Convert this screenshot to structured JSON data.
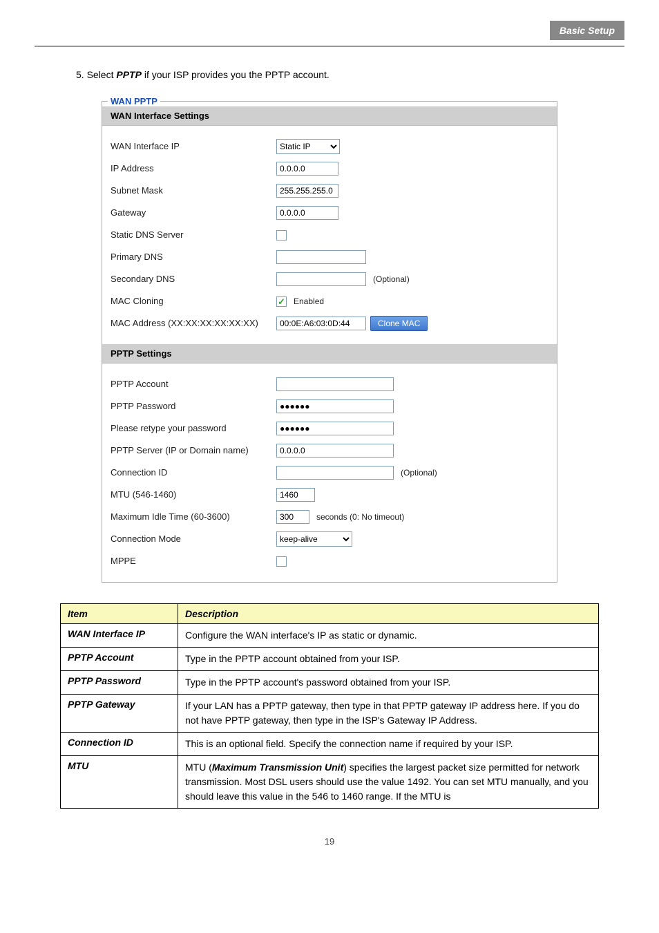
{
  "header": {
    "title_label": "Basic Setup"
  },
  "intro": {
    "text_prefix": "5. Select ",
    "bold_word": "PPTP",
    "text_suffix": " if your ISP provides you the PPTP account."
  },
  "panel": {
    "legend": "WAN PPTP",
    "section1_title": "WAN Interface Settings",
    "section2_title": "PPTP Settings",
    "labels": {
      "wan_if_ip": "WAN Interface IP",
      "ip_addr": "IP Address",
      "subnet": "Subnet Mask",
      "gateway": "Gateway",
      "static_dns": "Static DNS Server",
      "primary_dns": "Primary DNS",
      "secondary_dns": "Secondary DNS",
      "mac_cloning": "MAC Cloning",
      "mac_addr": "MAC Address (XX:XX:XX:XX:XX:XX)",
      "pptp_account": "PPTP Account",
      "pptp_password": "PPTP Password",
      "retype_pw": "Please retype your password",
      "pptp_server": "PPTP Server (IP or Domain name)",
      "conn_id": "Connection ID",
      "mtu": "MTU (546-1460)",
      "max_idle": "Maximum Idle Time (60-3600)",
      "conn_mode": "Connection Mode",
      "mppe": "MPPE"
    },
    "values": {
      "wan_if_ip_select": "Static IP",
      "ip_addr": "0.0.0.0",
      "subnet": "255.255.255.0",
      "gateway": "0.0.0.0",
      "primary_dns": "",
      "secondary_dns": "",
      "mac_cloning_label": "Enabled",
      "mac_addr": "00:0E:A6:03:0D:44",
      "clone_btn": "Clone MAC",
      "pptp_account": "",
      "pptp_password": "●●●●●●",
      "retype_pw": "●●●●●●",
      "pptp_server": "0.0.0.0",
      "conn_id": "",
      "mtu": "1460",
      "max_idle": "300",
      "max_idle_suffix": "seconds (0: No timeout)",
      "conn_mode_select": "keep-alive",
      "optional": "(Optional)"
    }
  },
  "desc_table": {
    "header_item": "Item",
    "header_desc": "Description",
    "rows": [
      {
        "name": "WAN Interface IP",
        "desc": "Configure the WAN interface's IP as static or dynamic."
      },
      {
        "name": "PPTP Account",
        "desc": "Type in the PPTP account obtained from your ISP."
      },
      {
        "name": "PPTP Password",
        "desc": "Type in the PPTP account's password obtained from your ISP."
      },
      {
        "name": "PPTP Gateway",
        "desc": "If your LAN has a PPTP gateway, then type in that PPTP gateway IP address here. If you do not have PPTP gateway, then type in the ISP's Gateway IP Address."
      },
      {
        "name": "Connection ID",
        "desc": "This is an optional field. Specify the connection name if required by your ISP."
      },
      {
        "name": "MTU",
        "desc_prefix": "MTU (",
        "desc_bold": "Maximum Transmission Unit",
        "desc_suffix": ") specifies the largest packet size permitted for network transmission. Most DSL users should use the value 1492. You can set MTU manually, and you should leave this value in the 546 to 1460 range. If the MTU is"
      }
    ]
  },
  "page_number": "19"
}
